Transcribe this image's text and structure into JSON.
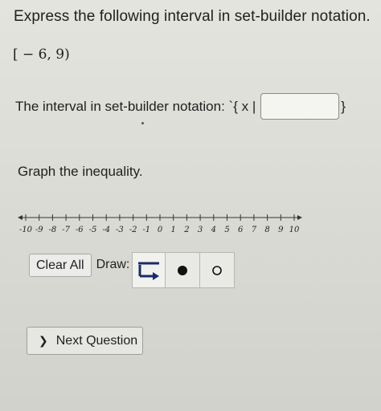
{
  "question": {
    "title": "Express the following interval in set-builder notation.",
    "interval": "[ − 6, 9)"
  },
  "set_builder": {
    "prompt": "The interval in set-builder notation: `{ x |",
    "answer_value": "",
    "close_brace": "}"
  },
  "graph": {
    "label": "Graph the inequality.",
    "number_line": {
      "min": -10,
      "max": 10,
      "tick_labels": [
        "-10",
        "-9",
        "-8",
        "-7",
        "-6",
        "-5",
        "-4",
        "-3",
        "-2",
        "-1",
        "0",
        "1",
        "2",
        "3",
        "4",
        "5",
        "6",
        "7",
        "8",
        "9",
        "10"
      ]
    }
  },
  "toolbar": {
    "clear_label": "Clear All",
    "draw_label": "Draw:",
    "tools": [
      "ray-tool-icon",
      "closed-dot-icon",
      "open-dot-icon"
    ]
  },
  "next_button": {
    "label": "Next Question"
  }
}
